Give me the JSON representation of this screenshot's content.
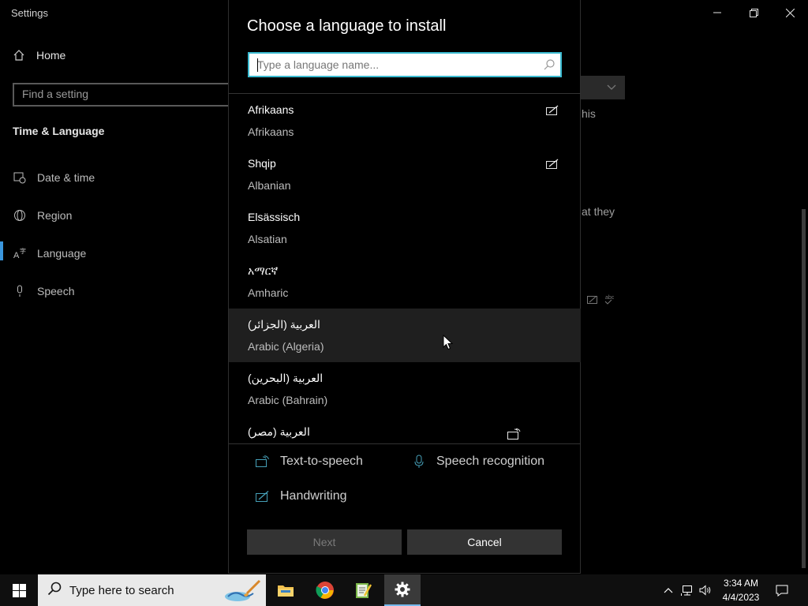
{
  "window": {
    "title": "Settings"
  },
  "nav": {
    "home_label": "Home",
    "find_placeholder": "Find a setting",
    "section_title": "Time & Language",
    "items": [
      {
        "label": "Date & time",
        "icon": "calendar-clock-icon"
      },
      {
        "label": "Region",
        "icon": "globe-icon"
      },
      {
        "label": "Language",
        "icon": "language-icon"
      },
      {
        "label": "Speech",
        "icon": "microphone-icon"
      }
    ]
  },
  "background_text": {
    "fragment1": "his",
    "fragment2": "at they"
  },
  "dialog": {
    "title": "Choose a language to install",
    "search_placeholder": "Type a language name...",
    "languages": [
      {
        "native": "Afrikaans",
        "english": "Afrikaans",
        "feature_icon": "handwriting-icon"
      },
      {
        "native": "Shqip",
        "english": "Albanian",
        "feature_icon": "handwriting-icon"
      },
      {
        "native": "Elsässisch",
        "english": "Alsatian"
      },
      {
        "native": "አማርኛ",
        "english": "Amharic"
      },
      {
        "native": "العربية (الجزائر)",
        "english": "Arabic (Algeria)"
      },
      {
        "native": "العربية (البحرين)",
        "english": "Arabic (Bahrain)"
      },
      {
        "native": "العربية (مصر)",
        "english": "",
        "feature_icon": "text-to-speech-icon"
      }
    ],
    "legend": {
      "tts": "Text-to-speech",
      "speech": "Speech recognition",
      "handwriting": "Handwriting"
    },
    "next_label": "Next",
    "cancel_label": "Cancel"
  },
  "taskbar": {
    "search_placeholder": "Type here to search",
    "time": "3:34 AM",
    "date": "4/4/2023"
  },
  "colors": {
    "accent": "#3bbbd1",
    "legend_icon": "#46a0b8",
    "selection_bar": "#3a96dd"
  }
}
